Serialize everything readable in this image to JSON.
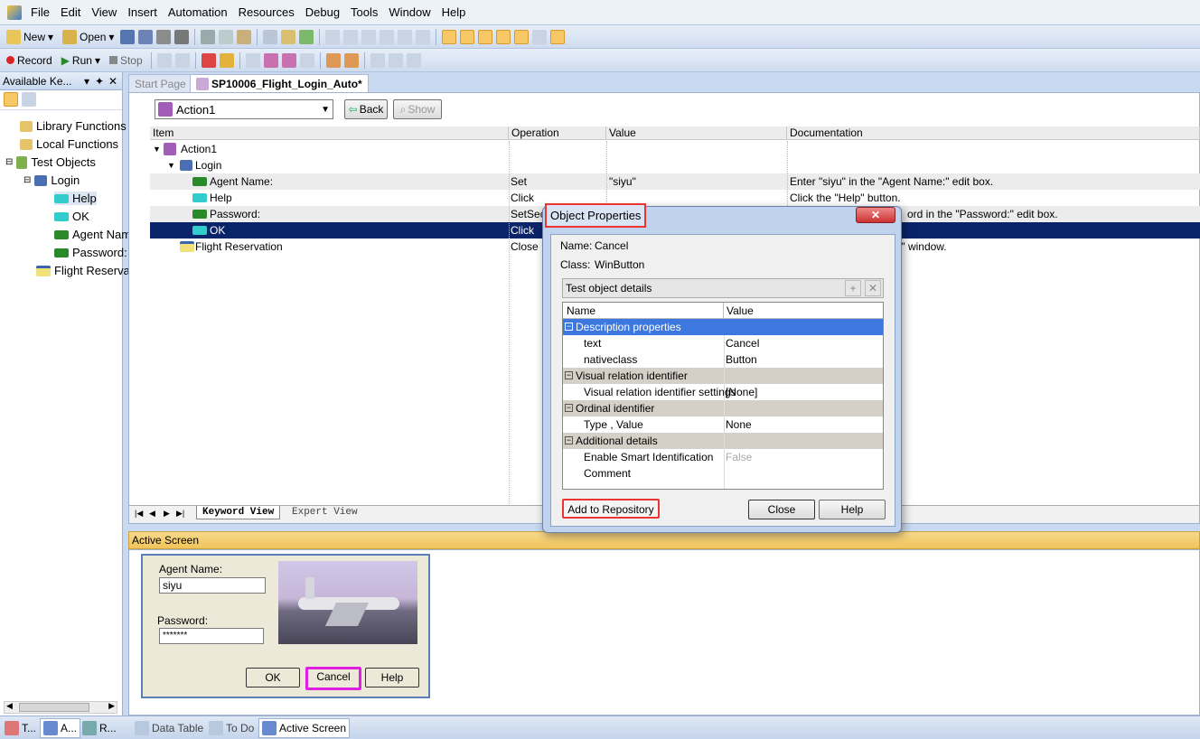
{
  "menu": [
    "File",
    "Edit",
    "View",
    "Insert",
    "Automation",
    "Resources",
    "Debug",
    "Tools",
    "Window",
    "Help"
  ],
  "toolbar1": {
    "new_label": "New",
    "open_label": "Open"
  },
  "toolbar2": {
    "record_label": "Record",
    "run_label": "Run",
    "stop_label": "Stop"
  },
  "left_panel": {
    "title": "Available Ke...",
    "tree": [
      "Library Functions",
      "Local Functions",
      "Test Objects",
      "Login",
      "Help",
      "OK",
      "Agent Name:",
      "Password:",
      "Flight Reservation"
    ]
  },
  "doc_tabs": [
    "Start Page",
    "SP10006_Flight_Login_Auto*"
  ],
  "action_selector": {
    "value": "Action1",
    "back_label": "Back",
    "show_label": "Show"
  },
  "grid": {
    "headers": [
      "Item",
      "Operation",
      "Value",
      "Documentation"
    ],
    "rows": [
      {
        "item": "Action1",
        "op": "",
        "value": "",
        "doc": ""
      },
      {
        "item": "Login",
        "op": "",
        "value": "",
        "doc": ""
      },
      {
        "item": "Agent Name:",
        "op": "Set",
        "value": "\"siyu\"",
        "doc": "Enter \"siyu\" in the \"Agent Name:\" edit box."
      },
      {
        "item": "Help",
        "op": "Click",
        "value": "",
        "doc": "Click the \"Help\" button."
      },
      {
        "item": "Password:",
        "op": "SetSec",
        "value": "",
        "doc": "ord in the \"Password:\" edit box."
      },
      {
        "item": "OK",
        "op": "Click",
        "value": "",
        "doc": ""
      },
      {
        "item": "Flight Reservation",
        "op": "Close",
        "value": "",
        "doc": "on\" window."
      }
    ]
  },
  "view_tabs": [
    "Keyword View",
    "Expert View"
  ],
  "dialog": {
    "title": "Object Properties",
    "name_label": "Name:",
    "name_value": "Cancel",
    "class_label": "Class:",
    "class_value": "WinButton",
    "details_label": "Test object details",
    "col_name": "Name",
    "col_value": "Value",
    "rows": [
      {
        "name": "Description properties",
        "value": "",
        "cat": true
      },
      {
        "name": "text",
        "value": "Cancel"
      },
      {
        "name": "nativeclass",
        "value": "Button"
      },
      {
        "name": "Visual relation identifier",
        "value": "",
        "cat": true
      },
      {
        "name": "Visual relation identifier settings",
        "value": "[None]"
      },
      {
        "name": "Ordinal identifier",
        "value": "",
        "cat": true
      },
      {
        "name": "Type , Value",
        "value": "None"
      },
      {
        "name": "Additional details",
        "value": "",
        "cat": true
      },
      {
        "name": "Enable Smart Identification",
        "value": "False"
      },
      {
        "name": "Comment",
        "value": ""
      }
    ],
    "add_label": "Add to Repository",
    "close_label": "Close",
    "help_label": "Help"
  },
  "active_screen": {
    "title": "Active Screen",
    "agent_label": "Agent Name:",
    "agent_value": "siyu",
    "password_label": "Password:",
    "password_value": "*******",
    "ok_label": "OK",
    "cancel_label": "Cancel",
    "help_label": "Help"
  },
  "status_tabs": [
    "T...",
    "A...",
    "R...",
    "Data Table",
    "To Do",
    "Active Screen"
  ]
}
